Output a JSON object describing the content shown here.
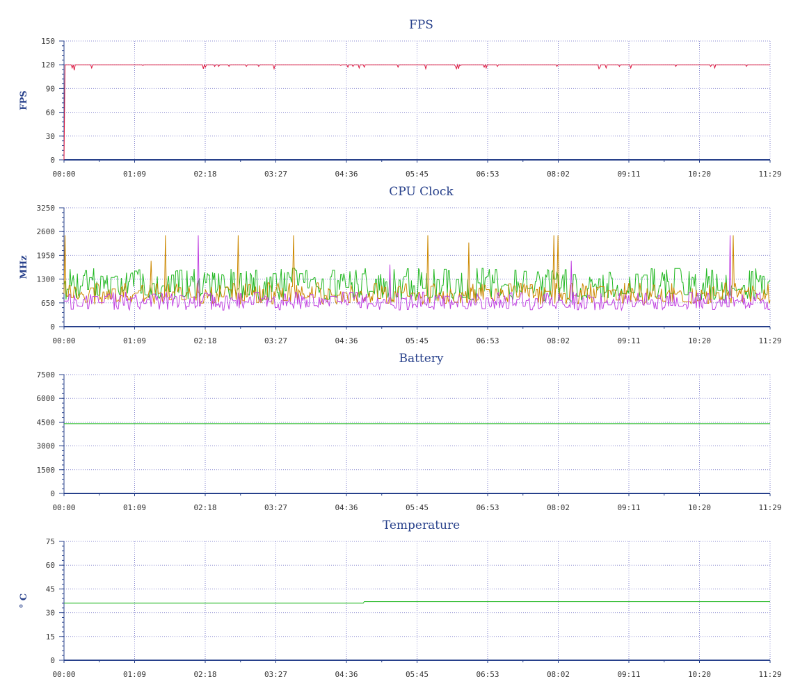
{
  "chart_data": [
    {
      "id": "fps",
      "type": "line",
      "title": "FPS",
      "xlabel": "",
      "ylabel": "FPS",
      "x_tick_labels": [
        "00:00",
        "01:09",
        "02:18",
        "03:27",
        "04:36",
        "05:45",
        "06:53",
        "08:02",
        "09:11",
        "10:20",
        "11:29"
      ],
      "xlim": [
        0,
        689
      ],
      "ylim": [
        0,
        150
      ],
      "y_ticks": [
        0,
        30,
        60,
        90,
        120,
        150
      ],
      "grid": true,
      "series": [
        {
          "color": "#dc143c",
          "style": "fps",
          "values": [
            0,
            120,
            113,
            119,
            118
          ]
        }
      ]
    },
    {
      "id": "cpu",
      "type": "line",
      "title": "CPU Clock",
      "xlabel": "",
      "ylabel": "MHz",
      "x_tick_labels": [
        "00:00",
        "01:09",
        "02:18",
        "03:27",
        "04:36",
        "05:45",
        "06:53",
        "08:02",
        "09:11",
        "10:20",
        "11:29"
      ],
      "xlim": [
        0,
        689
      ],
      "ylim": [
        0,
        3250
      ],
      "y_ticks": [
        0,
        650,
        1300,
        1950,
        2600,
        3250
      ],
      "grid": true,
      "series": [
        {
          "color": "#22b822",
          "style": "noisy",
          "base": 1150,
          "amplitude": 450,
          "seed": 7
        },
        {
          "color": "#cc8800",
          "style": "noisy",
          "base": 900,
          "amplitude": 300,
          "seed": 21,
          "spikes": [
            {
              "x": 1,
              "y": 2500
            },
            {
              "x": 85,
              "y": 1800
            },
            {
              "x": 99,
              "y": 2500
            },
            {
              "x": 170,
              "y": 2500
            },
            {
              "x": 224,
              "y": 2500
            },
            {
              "x": 355,
              "y": 2500
            },
            {
              "x": 395,
              "y": 2300
            },
            {
              "x": 478,
              "y": 2500
            },
            {
              "x": 482,
              "y": 2500
            },
            {
              "x": 653,
              "y": 2500
            }
          ]
        },
        {
          "color": "#c040e0",
          "style": "noisy",
          "base": 700,
          "amplitude": 250,
          "seed": 43,
          "spikes": [
            {
              "x": 131,
              "y": 2500
            },
            {
              "x": 318,
              "y": 1700
            },
            {
              "x": 495,
              "y": 1800
            },
            {
              "x": 650,
              "y": 2500
            }
          ]
        }
      ]
    },
    {
      "id": "battery",
      "type": "line",
      "title": "Battery",
      "xlabel": "",
      "ylabel": "",
      "x_tick_labels": [
        "00:00",
        "01:09",
        "02:18",
        "03:27",
        "04:36",
        "05:45",
        "06:53",
        "08:02",
        "09:11",
        "10:20",
        "11:29"
      ],
      "xlim": [
        0,
        689
      ],
      "ylim": [
        0,
        7500
      ],
      "y_ticks": [
        0,
        1500,
        3000,
        4500,
        6000,
        7500
      ],
      "grid": true,
      "series": [
        {
          "color": "#22b822",
          "style": "flat",
          "values": [
            4400,
            4400
          ]
        }
      ]
    },
    {
      "id": "temperature",
      "type": "line",
      "title": "Temperature",
      "xlabel": "",
      "ylabel": "° C",
      "x_tick_labels": [
        "00:00",
        "01:09",
        "02:18",
        "03:27",
        "04:36",
        "05:45",
        "06:53",
        "08:02",
        "09:11",
        "10:20",
        "11:29"
      ],
      "xlim": [
        0,
        689
      ],
      "ylim": [
        0,
        75
      ],
      "y_ticks": [
        0,
        15,
        30,
        45,
        60,
        75
      ],
      "grid": true,
      "series": [
        {
          "color": "#22b822",
          "style": "step",
          "points": [
            [
              0,
              36
            ],
            [
              292,
              36
            ],
            [
              293,
              37
            ],
            [
              689,
              37
            ]
          ]
        }
      ]
    }
  ]
}
